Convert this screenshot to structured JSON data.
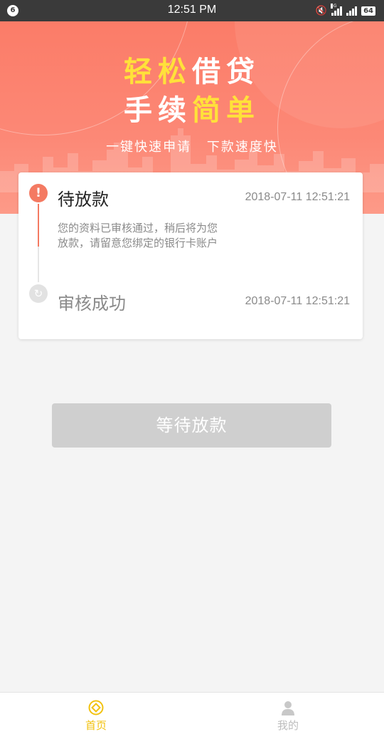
{
  "status_bar": {
    "notification_count": "6",
    "time": "12:51 PM",
    "network_label": "4G",
    "battery": "64",
    "icons": [
      "mute-icon",
      "signal-icon",
      "battery-icon"
    ]
  },
  "banner": {
    "line1_part_a": "轻松",
    "line1_part_b": "借贷",
    "line2_part_a": "手续",
    "line2_part_b": "简单",
    "subtitle_a": "一键快速申请",
    "subtitle_b": "下款速度快",
    "colors": {
      "accent_yellow": "#ffe13a",
      "banner_bg": "#fb7c68"
    }
  },
  "progress": {
    "steps": [
      {
        "title": "待放款",
        "time": "2018-07-11 12:51:21",
        "desc": "您的资料已审核通过，稍后将为您放款，请留意您绑定的银行卡账户",
        "icon": "alert-icon",
        "state": "current"
      },
      {
        "title": "审核成功",
        "time": "2018-07-11 12:51:21",
        "icon": "refresh-icon",
        "state": "done"
      }
    ],
    "colors": {
      "active": "#f47a62",
      "inactive": "#e2e2e2"
    }
  },
  "action": {
    "label": "等待放款",
    "enabled": false
  },
  "tab_bar": {
    "items": [
      {
        "label": "首页",
        "icon": "home-coin-icon",
        "active": true
      },
      {
        "label": "我的",
        "icon": "user-icon",
        "active": false
      }
    ],
    "colors": {
      "active": "#f2c20f",
      "inactive": "#bdbdbd"
    }
  }
}
